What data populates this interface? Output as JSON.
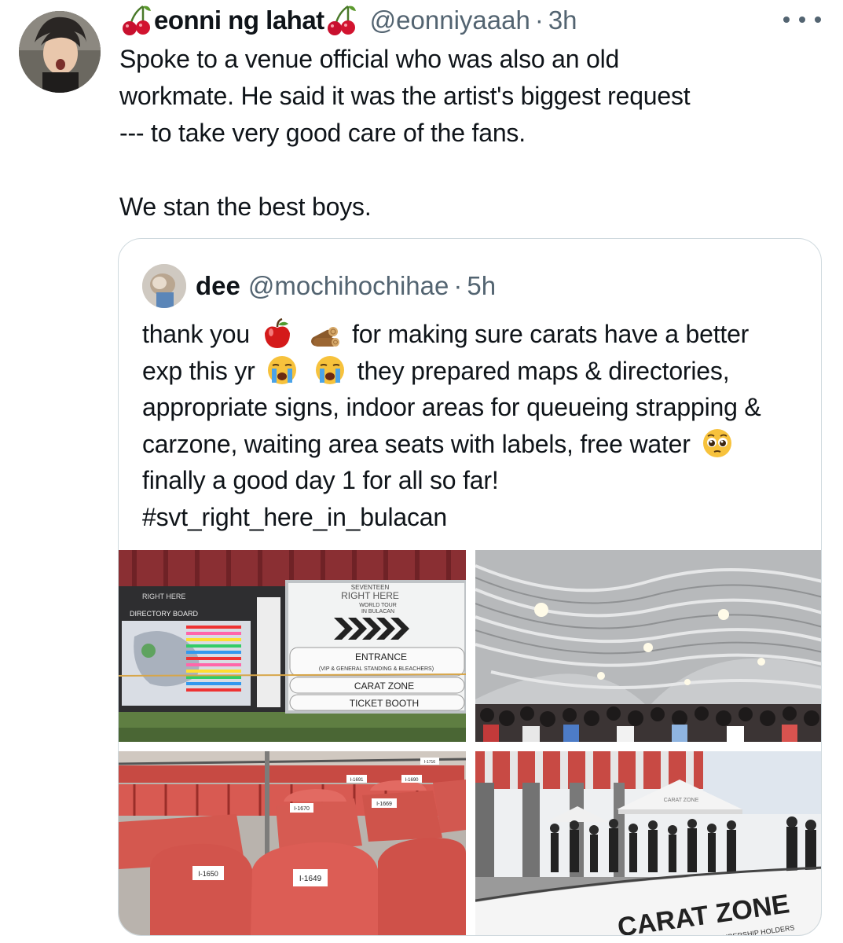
{
  "tweet": {
    "display_name": "eonni ng lahat",
    "name_emoji": "cherry-icon",
    "handle": "@eonniyaaah",
    "separator": "·",
    "time": "3h",
    "text": "Spoke to a venue official who was also an old\nworkmate. He said it was the artist's biggest request\n--- to take very good care of the fans.\n\nWe stan the best boys."
  },
  "quoted": {
    "display_name": "dee",
    "handle": "@mochihochihae",
    "separator": "·",
    "time": "5h",
    "text_part1": "thank you",
    "text_part2": "for making sure carats have a better exp this yr",
    "text_part3": "they prepared maps & directories, appropriate signs, indoor areas for queueing strapping & carzone, waiting area seats with labels, free water",
    "text_part4": "finally a good day 1 for all so far! #svt_right_here_in_bulacan",
    "emojis": [
      "apple-icon",
      "wood-icon",
      "crying-face-icon",
      "crying-face-icon",
      "pleading-face-icon"
    ],
    "photos": {
      "directory": {
        "board_title": "DIRECTORY BOARD",
        "board_logo": "RIGHT HERE",
        "sign_brand": "SEVENTEEN",
        "sign_logo": "RIGHT HERE",
        "sign_tour": "WORLD TOUR",
        "sign_city": "IN BULACAN",
        "entrance": "ENTRANCE",
        "entrance_sub": "(VIP & GENERAL STANDING & BLEACHERS)",
        "carat_zone": "CARAT ZONE",
        "ticket_booth": "TICKET BOOTH"
      },
      "seats": {
        "labels": [
          "I-1650",
          "I-1649",
          "I-1670",
          "I-1669",
          "I-1691",
          "I-1690",
          "I-1716"
        ]
      },
      "outdoor": {
        "banner": "CARAT ZONE",
        "banner_sub": "MEMBERSHIP HOLDERS",
        "tent_label": "CARAT ZONE"
      }
    }
  },
  "colors": {
    "text": "#0f1419",
    "muted": "#536471",
    "border": "#cfd9de"
  }
}
